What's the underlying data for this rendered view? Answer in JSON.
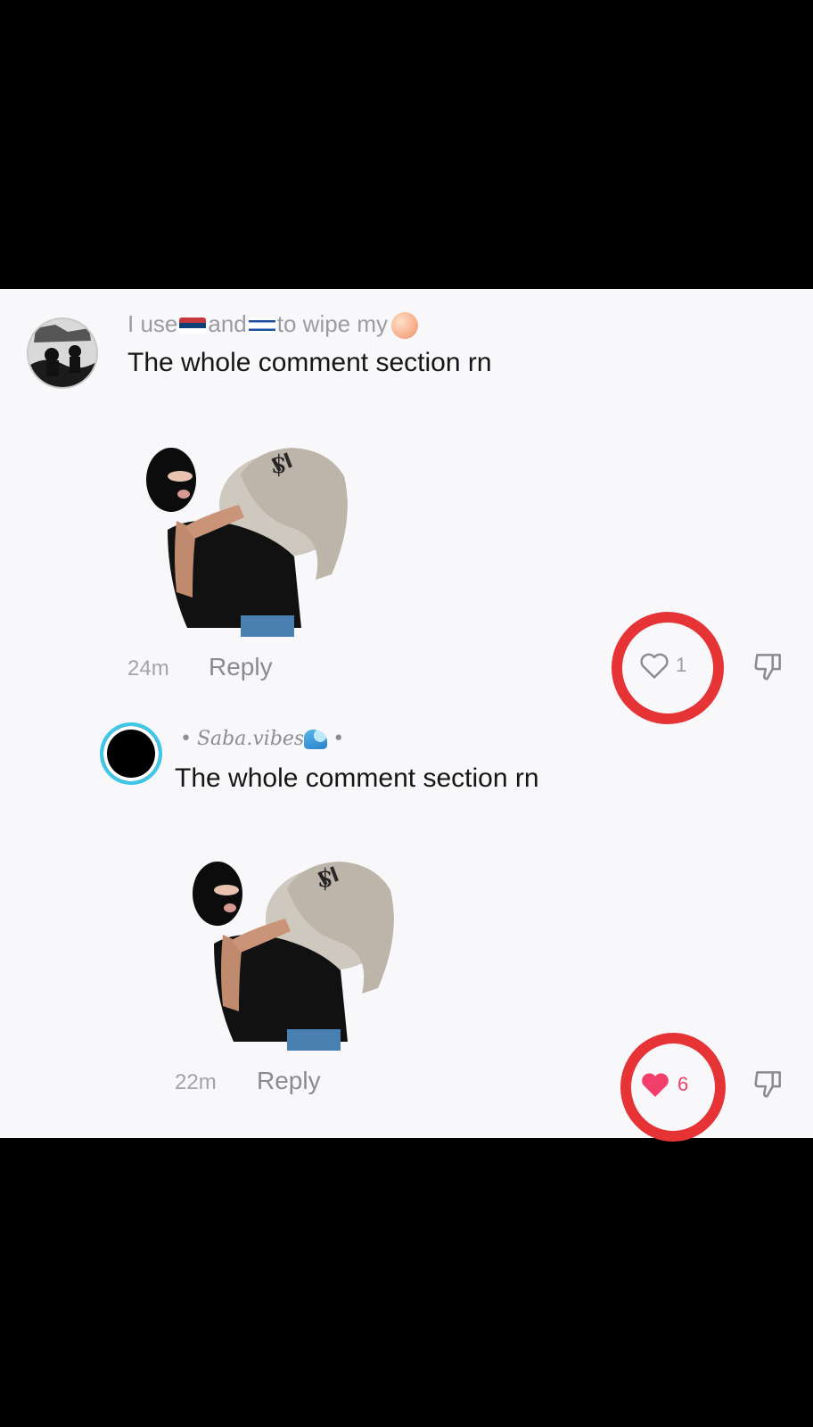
{
  "comments": [
    {
      "username_parts": [
        "I use",
        "and",
        "to wipe my"
      ],
      "text": "The whole comment section rn",
      "time": "24m",
      "reply_label": "Reply",
      "like_count": "1",
      "liked": false
    },
    {
      "username": "Saba.vibes",
      "text": "The whole comment section rn",
      "time": "22m",
      "reply_label": "Reply",
      "like_count": "6",
      "liked": true
    }
  ],
  "icons": {
    "flags": [
      "serbia-flag-icon",
      "israel-flag-icon"
    ],
    "emoji": [
      "peach-icon",
      "wave-icon"
    ],
    "actions": [
      "heart-outline-icon",
      "heart-filled-icon",
      "dislike-icon"
    ]
  },
  "colors": {
    "highlight_ring": "#e53336",
    "liked_heart": "#f23e6b",
    "avatar_ring": "#3ec7e6",
    "panel_bg": "#f8f8fa"
  }
}
